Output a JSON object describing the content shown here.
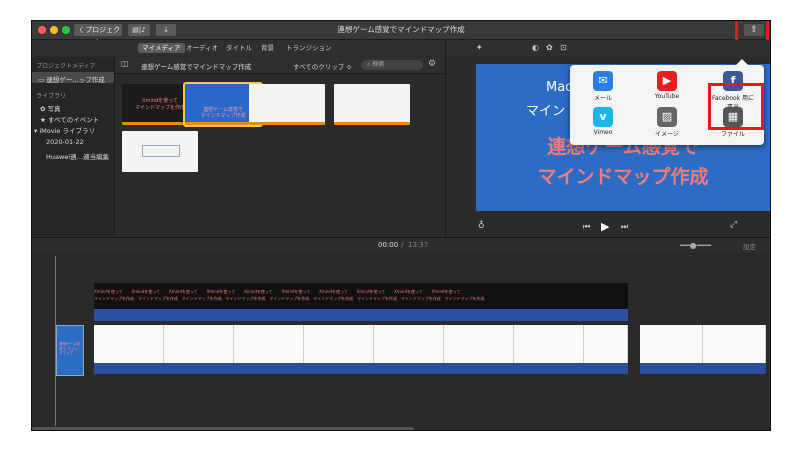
{
  "window": {
    "back_label": "〈 プロジェクト",
    "title": "連想ゲーム感覚でマインドマップ作成",
    "share_icon": "share-icon"
  },
  "tabs": [
    "マイメディア",
    "オーディオ",
    "タイトル",
    "背景",
    "トランジション"
  ],
  "sidebar": {
    "project_header": "プロジェクトメディア",
    "project_item": "連想ゲー…ップ作成",
    "library_header": "ライブラリ",
    "photos": "写真",
    "all_events": "すべてのイベント",
    "imovie_library": "iMovie ライブラリ",
    "event_date": "2020-01-22",
    "event_other": "Huawei週…適当編集"
  },
  "browser": {
    "header_title": "連想ゲーム感覚でマインドマップ作成",
    "filter": "すべてのクリップ ≎",
    "search_placeholder": "検索",
    "clips": [
      {
        "line1": "Xmindを使って",
        "line2": "マインドマップを作成"
      },
      {
        "line1": "連想ゲーム感覚で",
        "line2": "マインドマップ作成"
      },
      {
        "line1": "",
        "line2": ""
      },
      {
        "line1": "",
        "line2": ""
      },
      {
        "line1": "",
        "line2": ""
      }
    ]
  },
  "viewer": {
    "preview_line_partial1": "Mac",
    "preview_line_partial2": "マイン",
    "preview_title1": "連想ゲーム感覚で",
    "preview_title2": "マインドマップ作成"
  },
  "share_popup": {
    "items": [
      {
        "label": "メール",
        "icon": "mail-icon",
        "color": "#2a7de1"
      },
      {
        "label": "YouTube",
        "icon": "youtube-icon",
        "color": "#e0221c"
      },
      {
        "label": "Facebook 用に書出",
        "icon": "facebook-icon",
        "color": "#3b5998"
      },
      {
        "label": "Vimeo",
        "icon": "vimeo-icon",
        "color": "#1ab7ea"
      },
      {
        "label": "イメージ",
        "icon": "image-icon",
        "color": "#666666"
      },
      {
        "label": "ファイル",
        "icon": "film-file-icon",
        "color": "#555555"
      }
    ]
  },
  "timeline": {
    "current_time": "00:00",
    "separator": "/",
    "total_time": "13:37",
    "settings_label": "設定",
    "title_clip_line1": "Xmindを使って",
    "title_clip_line2": "マインドマップを作成",
    "first_clip_text": "連想ゲーム感覚で マインドマップ"
  },
  "colors": {
    "highlight": "#e21b1b",
    "accent_blue": "#2d6cc4"
  }
}
